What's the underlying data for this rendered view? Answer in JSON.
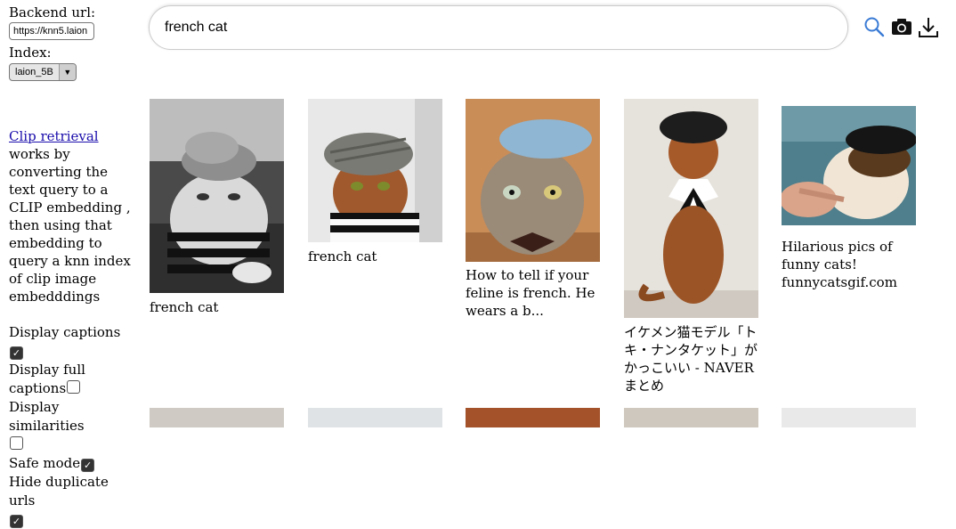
{
  "sidebar": {
    "backend_label": "Backend url:",
    "backend_value": "https://knn5.laion",
    "index_label": "Index:",
    "index_value": "laion_5B",
    "desc_link": "Clip retrieval",
    "desc_text": " works by converting the text query to a CLIP embedding , then using that embedding to query a knn index of clip image embedddings",
    "options": {
      "captions": {
        "label": "Display captions",
        "checked": true
      },
      "full_captions": {
        "label": "Display full captions",
        "checked": false
      },
      "similarities": {
        "label": "Display similarities",
        "checked": false
      },
      "safe": {
        "label": "Safe mode",
        "checked": true
      },
      "dedupe": {
        "label": "Hide duplicate urls",
        "checked": true
      }
    }
  },
  "search": {
    "query": "french cat",
    "icons": [
      "search-icon",
      "camera-icon",
      "download-icon"
    ]
  },
  "results": [
    {
      "caption": "french cat",
      "image": "black-and-white cat in beret and striped sweater"
    },
    {
      "caption": "french cat",
      "image": "abyssinian cat in herringbone flat cap and striped sweater"
    },
    {
      "caption": "How to tell if your feline is french. He wears a b...",
      "image": "tabby cat in blue beret with bow tie"
    },
    {
      "caption": "イケメン猫モデル「トキ・ナンタケット」がかっこいい - NAVER まとめ",
      "image": "abyssinian cat sitting with black beret and collar"
    },
    {
      "caption": "Hilarious pics of funny cats! funnycatsgif.com",
      "image": "cat in black beret being petted"
    }
  ]
}
